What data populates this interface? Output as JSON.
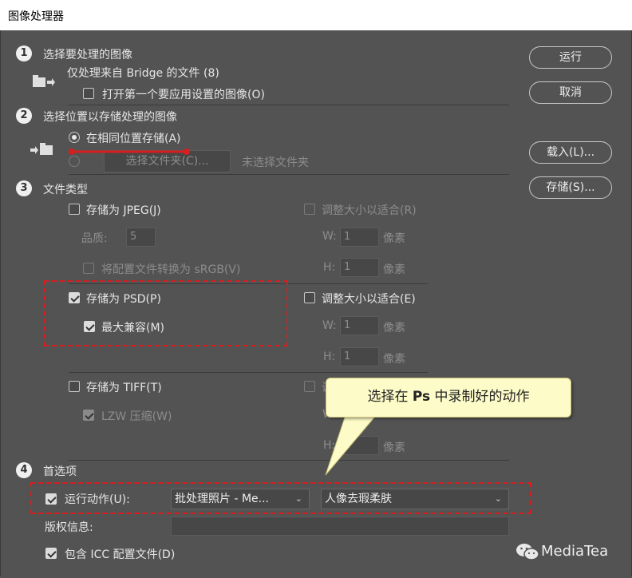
{
  "window": {
    "title": "图像处理器"
  },
  "section1": {
    "num": "1",
    "title": "选择要处理的图像",
    "source_text": "仅处理来自 Bridge 的文件 (8)",
    "open_first_label": "打开第一个要应用设置的图像(O)"
  },
  "section2": {
    "num": "2",
    "title": "选择位置以存储处理的图像",
    "same_location_label": "在相同位置存储(A)",
    "select_folder_label": "选择文件夹(C)...",
    "no_folder_text": "未选择文件夹"
  },
  "section3": {
    "num": "3",
    "title": "文件类型",
    "jpeg": {
      "save_label": "存储为 JPEG(J)",
      "resize_label": "调整大小以适合(R)",
      "quality_label": "品质:",
      "quality_value": "5",
      "w_label": "W:",
      "w_value": "1",
      "h_label": "H:",
      "h_value": "1",
      "unit": "像素",
      "srgb_label": "将配置文件转换为 sRGB(V)"
    },
    "psd": {
      "save_label": "存储为 PSD(P)",
      "resize_label": "调整大小以适合(E)",
      "max_compat_label": "最大兼容(M)",
      "w_label": "W:",
      "w_value": "1",
      "h_label": "H:",
      "h_value": "1",
      "unit": "像素"
    },
    "tiff": {
      "save_label": "存储为 TIFF(T)",
      "resize_label": "调",
      "lzw_label": "LZW 压缩(W)",
      "w_label": "W",
      "h_label": "H:",
      "h_value": "1",
      "unit": "像素"
    }
  },
  "section4": {
    "num": "4",
    "title": "首选项",
    "run_action_label": "运行动作(U):",
    "action_set": "批处理照片 - Me...",
    "action_name": "人像去瑕柔肤",
    "copyright_label": "版权信息:",
    "copyright_value": "",
    "icc_label": "包含 ICC 配置文件(D)"
  },
  "buttons": {
    "run": "运行",
    "cancel": "取消",
    "load": "载入(L)...",
    "save": "存储(S)..."
  },
  "callout": {
    "prefix": "选择在 ",
    "ps": "Ps",
    "suffix": " 中录制好的动作"
  },
  "watermark": {
    "text": "MediaTea"
  },
  "colors": {
    "annotation_red": "#d81e1e",
    "callout_bg": "#fdfcc8",
    "dialog_bg": "#535353"
  }
}
